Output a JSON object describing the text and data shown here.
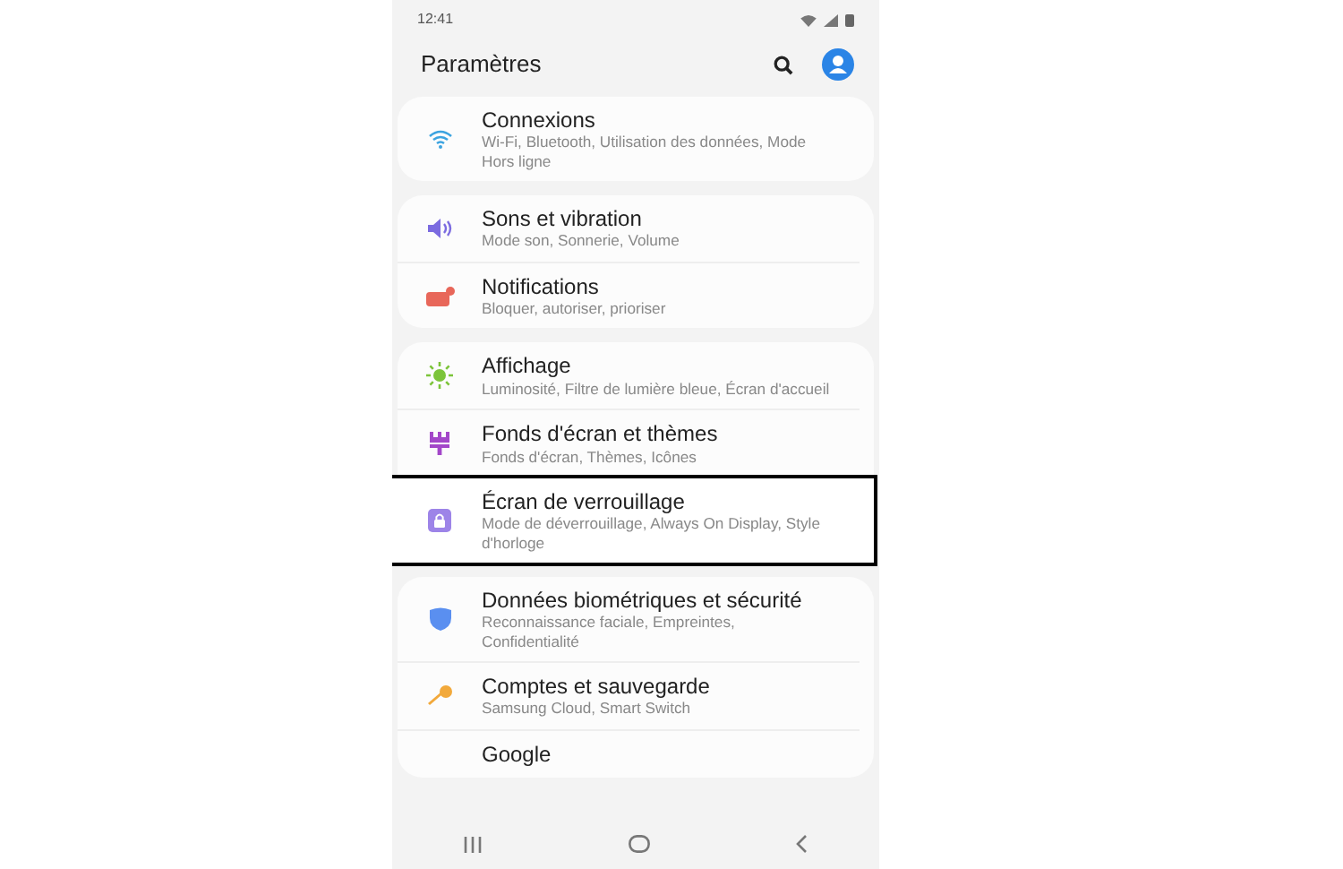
{
  "status_bar": {
    "time": "12:41"
  },
  "header": {
    "title": "Paramètres"
  },
  "groups": [
    {
      "items": [
        {
          "kind": "wifi",
          "title": "Connexions",
          "subtitle": "Wi-Fi, Bluetooth, Utilisation des données, Mode Hors ligne",
          "highlighted": false
        }
      ]
    },
    {
      "items": [
        {
          "kind": "sound",
          "title": "Sons et vibration",
          "subtitle": "Mode son, Sonnerie, Volume",
          "highlighted": false
        },
        {
          "kind": "notification",
          "title": "Notifications",
          "subtitle": "Bloquer, autoriser, prioriser",
          "highlighted": false
        }
      ]
    },
    {
      "items": [
        {
          "kind": "display",
          "title": "Affichage",
          "subtitle": "Luminosité, Filtre de lumière bleue, Écran d'accueil",
          "highlighted": false
        },
        {
          "kind": "wallpaper",
          "title": "Fonds d'écran et thèmes",
          "subtitle": "Fonds d'écran, Thèmes, Icônes",
          "highlighted": false
        },
        {
          "kind": "lock",
          "title": "Écran de verrouillage",
          "subtitle": "Mode de déverrouillage, Always On Display, Style d'horloge",
          "highlighted": true
        }
      ]
    },
    {
      "items": [
        {
          "kind": "shield",
          "title": "Données biométriques et sécurité",
          "subtitle": "Reconnaissance faciale, Empreintes, Confidentialité",
          "highlighted": false
        },
        {
          "kind": "key",
          "title": "Comptes et sauvegarde",
          "subtitle": "Samsung Cloud, Smart Switch",
          "highlighted": false
        },
        {
          "kind": "partial",
          "title": "Google",
          "highlighted": false
        }
      ]
    }
  ]
}
